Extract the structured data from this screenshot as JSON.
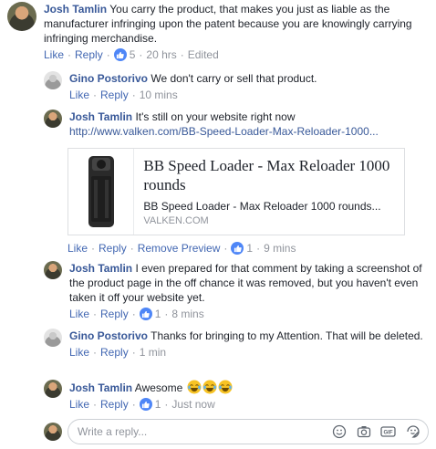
{
  "comments": [
    {
      "author": "Josh Tamlin",
      "text": "You carry the product, that makes you just as liable as the manufacturer infringing upon the patent because you are knowingly carrying infringing merchandise.",
      "like_label": "Like",
      "reply_label": "Reply",
      "likes": "5",
      "time": "20 hrs",
      "edited": "Edited"
    },
    {
      "author": "Gino Postorivo",
      "text": "We don't carry or sell that product.",
      "like_label": "Like",
      "reply_label": "Reply",
      "time": "10 mins"
    },
    {
      "author": "Josh Tamlin",
      "text": "It's still on your website right now",
      "link": "http://www.valken.com/BB-Speed-Loader-Max-Reloader-1000...",
      "like_label": "Like",
      "reply_label": "Reply",
      "remove_preview_label": "Remove Preview",
      "likes": "1",
      "time": "9 mins"
    },
    {
      "author": "Josh Tamlin",
      "text": "I even prepared for that comment by taking a screenshot of the product page in the off chance it was removed, but you haven't even taken it off your website yet.",
      "like_label": "Like",
      "reply_label": "Reply",
      "likes": "1",
      "time": "8 mins"
    },
    {
      "author": "Gino Postorivo",
      "text": "Thanks for bringing to my Attention. That will be deleted.",
      "like_label": "Like",
      "reply_label": "Reply",
      "time": "1 min"
    },
    {
      "author": "Josh Tamlin",
      "text": "Awesome",
      "like_label": "Like",
      "reply_label": "Reply",
      "likes": "1",
      "time": "Just now"
    }
  ],
  "link_preview": {
    "title": "BB Speed Loader - Max Reloader 1000 rounds",
    "description": "BB Speed Loader - Max Reloader 1000 rounds...",
    "domain": "VALKEN.COM"
  },
  "reply_box": {
    "placeholder": "Write a reply..."
  },
  "colors": {
    "author": "#385898",
    "action": "#4267b2",
    "meta": "#90949c",
    "like_badge": "#4e86f7"
  }
}
